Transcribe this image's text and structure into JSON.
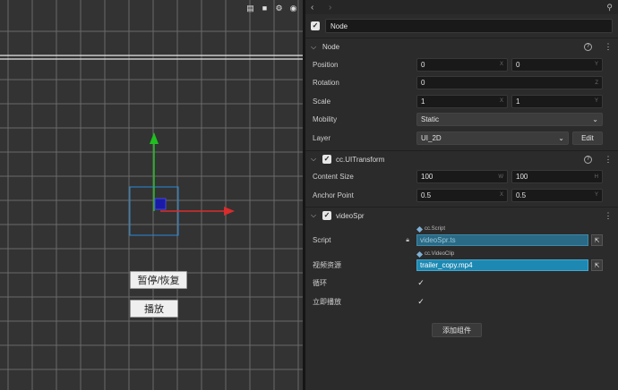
{
  "scene": {
    "toolbar": [
      {
        "name": "layout-icon",
        "glyph": "▤"
      },
      {
        "name": "camera-icon",
        "glyph": "■"
      },
      {
        "name": "gear-icon",
        "glyph": "⚙"
      },
      {
        "name": "globe-icon",
        "glyph": "◉"
      }
    ],
    "buttons": {
      "pause_resume": "暂停/恢复",
      "play": "播放"
    }
  },
  "inspector": {
    "nav_back": "‹",
    "nav_forward": "›",
    "pin_glyph": "⚲",
    "node_name": "Node",
    "node_section": {
      "title": "Node",
      "position": {
        "label": "Position",
        "x": "0",
        "y": "0"
      },
      "rotation": {
        "label": "Rotation",
        "z": "0"
      },
      "scale": {
        "label": "Scale",
        "x": "1",
        "y": "1"
      },
      "mobility": {
        "label": "Mobility",
        "value": "Static"
      },
      "layer": {
        "label": "Layer",
        "value": "UI_2D",
        "edit": "Edit"
      }
    },
    "uitransform": {
      "title": "cc.UITransform",
      "content_size": {
        "label": "Content Size",
        "w": "100",
        "h": "100"
      },
      "anchor_point": {
        "label": "Anchor Point",
        "x": "0.5",
        "y": "0.5"
      }
    },
    "videospr": {
      "title": "videoSpr",
      "script": {
        "label": "Script",
        "tag": "cc.Script",
        "value": "videoSpr.ts"
      },
      "video_resource": {
        "label": "视频资源",
        "tag": "cc.VideoClip",
        "value": "trailer_copy.mp4"
      },
      "loop": {
        "label": "循环",
        "checked": true
      },
      "autoplay": {
        "label": "立即播放",
        "checked": true
      }
    },
    "add_component": "添加组件",
    "axis": {
      "x": "X",
      "y": "Y",
      "z": "Z",
      "w": "W",
      "h": "H"
    }
  }
}
